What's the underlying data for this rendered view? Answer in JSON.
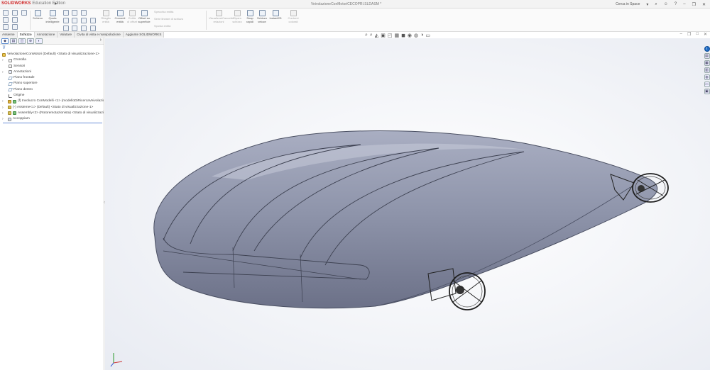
{
  "app": {
    "brand": "SOLIDWORKS",
    "edition": "Education Edition",
    "document_title": "VeivolazioneConMotoriCECOPRI.SLDASM *",
    "search_placeholder": "Cerca in Space"
  },
  "ribbon": {
    "schizzo": "Schizzo",
    "quota_intelligente": "Quota intelligente",
    "ritaglia_entita": "Ritaglia entità",
    "converti_entita": "Converti entità",
    "entita_offset": "Entità di offset",
    "offset_superficie": "Offset su superficie",
    "specchia_entita": "Specchia entità",
    "serie_lineare": "Serie lineare di schizzo",
    "sposta_entita": "Sposta entità",
    "visualizza_relazioni": "Visualizza/Cancella relazioni",
    "ripara_schizzo": "Ripara schizzo",
    "snap_rapidi": "Snap rapidi",
    "schizzo_veloce": "Schizzo veloce",
    "instant2d": "Instant2D",
    "contorni_colorati": "Contorni colorati"
  },
  "tabs": [
    "Assieme",
    "Schizzo",
    "Annotazione",
    "Valutare",
    "Civita di vista e manipolazione",
    "Aggiunte SOLIDWORKS"
  ],
  "active_tab_index": 1,
  "tree": {
    "items": [
      {
        "label": "VeivolazioneConMotori (Default) <Stato di visualizzazione-1>",
        "icon": "assembly-root-icon"
      },
      {
        "label": "Cronolla",
        "icon": "history-icon"
      },
      {
        "label": "Sensori",
        "icon": "sensor-icon"
      },
      {
        "label": "Annotazioni",
        "icon": "annotation-icon"
      },
      {
        "label": "Piano frontale",
        "icon": "plane-icon"
      },
      {
        "label": "Piano superiore",
        "icon": "plane-icon"
      },
      {
        "label": "Piano destro",
        "icon": "plane-icon"
      },
      {
        "label": "Origine",
        "icon": "origin-icon"
      },
      {
        "label": "(f) Involucro ConModelli <1> (modelloDiRicercaVeivolazioneAR",
        "icon": "part-icon"
      },
      {
        "label": "(-) Assieme<1> (Default) <Stato di visualizzazione-1>",
        "icon": "subassembly-icon"
      },
      {
        "label": "Assembly<2> (Rotoremotazionista) <Stato di visualizzazio",
        "icon": "subassembly-icon"
      },
      {
        "label": "Accoppiam",
        "icon": "mates-icon"
      }
    ]
  },
  "colors": {
    "hull_body": "#8c92a8",
    "hull_edge": "#3c4050",
    "accent": "#1f6cc6",
    "brand": "#d02b2b"
  }
}
